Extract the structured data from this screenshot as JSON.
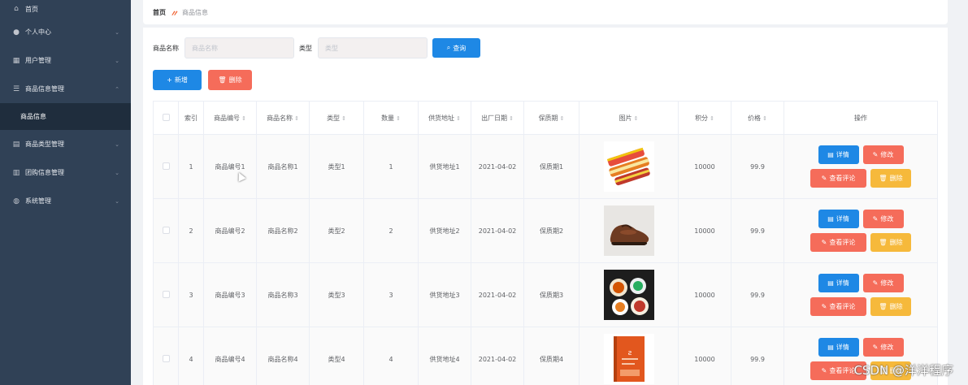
{
  "sidebar": {
    "items": [
      {
        "label": "首页",
        "icon": "home-icon",
        "glyph": "⌂",
        "arrow": ""
      },
      {
        "label": "个人中心",
        "icon": "user-icon",
        "glyph": "👤",
        "arrow": "⌄"
      },
      {
        "label": "用户管理",
        "icon": "grid-icon",
        "glyph": "▦",
        "arrow": "⌄"
      },
      {
        "label": "商品信息管理",
        "icon": "list-icon",
        "glyph": "☰",
        "arrow": "⌃"
      },
      {
        "label": "商品信息",
        "icon": "",
        "glyph": "",
        "arrow": ""
      },
      {
        "label": "商品类型管理",
        "icon": "note-icon",
        "glyph": "▤",
        "arrow": "⌄"
      },
      {
        "label": "团购信息管理",
        "icon": "doc-icon",
        "glyph": "▥",
        "arrow": "⌄"
      },
      {
        "label": "系统管理",
        "icon": "globe-icon",
        "glyph": "◍",
        "arrow": "⌄"
      }
    ]
  },
  "breadcrumb": {
    "home": "首页",
    "separator": "〃",
    "current": "商品信息"
  },
  "search": {
    "name_label": "商品名称",
    "name_placeholder": "商品名称",
    "type_label": "类型",
    "type_placeholder": "类型",
    "query_label": "查询"
  },
  "actions": {
    "add_label": "新增",
    "delete_label": "删除"
  },
  "table": {
    "headers": [
      "索引",
      "商品编号",
      "商品名称",
      "类型",
      "数量",
      "供货地址",
      "出厂日期",
      "保质期",
      "图片",
      "积分",
      "价格",
      "操作"
    ],
    "rows": [
      {
        "index": "1",
        "code": "商品编号1",
        "name": "商品名称1",
        "type": "类型1",
        "qty": "1",
        "addr": "供货地址1",
        "date": "2021-04-02",
        "shelf": "保质期1",
        "image": "chips",
        "points": "10000",
        "price": "99.9"
      },
      {
        "index": "2",
        "code": "商品编号2",
        "name": "商品名称2",
        "type": "类型2",
        "qty": "2",
        "addr": "供货地址2",
        "date": "2021-04-02",
        "shelf": "保质期2",
        "image": "shoe",
        "points": "10000",
        "price": "99.9"
      },
      {
        "index": "3",
        "code": "商品编号3",
        "name": "商品名称3",
        "type": "类型3",
        "qty": "3",
        "addr": "供货地址3",
        "date": "2021-04-02",
        "shelf": "保质期3",
        "image": "food",
        "points": "10000",
        "price": "99.9"
      },
      {
        "index": "4",
        "code": "商品编号4",
        "name": "商品名称4",
        "type": "类型4",
        "qty": "4",
        "addr": "供货地址4",
        "date": "2021-04-02",
        "shelf": "保质期4",
        "image": "book",
        "points": "10000",
        "price": "99.9"
      }
    ],
    "ops": {
      "detail": "详情",
      "edit": "修改",
      "review": "查看评论",
      "remove": "删除"
    }
  },
  "watermark": "CSDN @洋洋程序",
  "colors": {
    "sidebar": "#304156",
    "primary": "#1e88e5",
    "danger": "#f56c5a",
    "warning": "#f6b93b"
  }
}
